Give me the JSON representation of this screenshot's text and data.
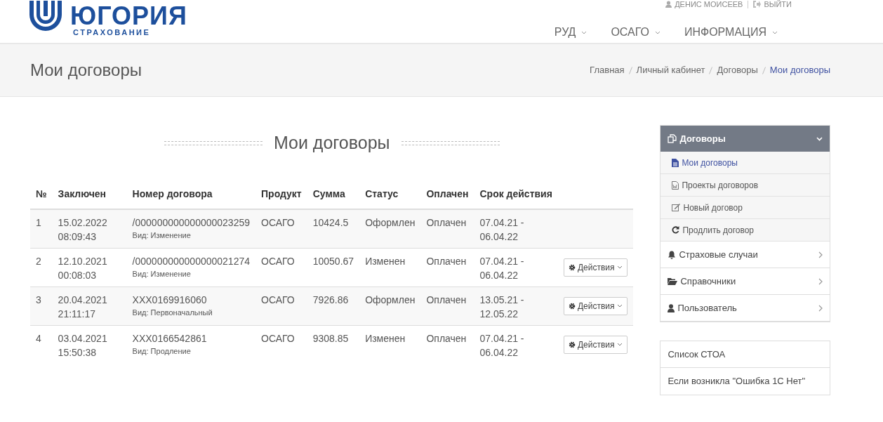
{
  "header": {
    "logo": {
      "name": "ЮГОРИЯ",
      "tagline": "СТРАХОВАНИЕ"
    },
    "user": "ДЕНИС МОИСЕЕВ",
    "logout": "ВЫЙТИ",
    "nav": [
      "РУД",
      "ОСАГО",
      "ИНФОРМАЦИЯ"
    ]
  },
  "page_title": "Мои договоры",
  "breadcrumb": [
    {
      "label": "Главная",
      "selected": false
    },
    {
      "label": "Личный кабинет",
      "selected": false
    },
    {
      "label": "Договоры",
      "selected": false
    },
    {
      "label": "Мои договоры",
      "selected": true
    }
  ],
  "section_title": "Мои договоры",
  "table": {
    "columns": [
      "№",
      "Заключен",
      "Номер договора",
      "Продукт",
      "Сумма",
      "Статус",
      "Оплачен",
      "Срок действия"
    ],
    "rows": [
      {
        "no": "1",
        "concluded": "15.02.2022 08:09:43",
        "number": "/000000000000000023259",
        "kind_label": "Вид: Изменение",
        "product": "ОСАГО",
        "sum": "10424.5",
        "status": "Оформлен",
        "paid": "Оплачен",
        "term": "07.04.21 - 06.04.22"
      },
      {
        "no": "2",
        "concluded": "12.10.2021 00:08:03",
        "number": "/000000000000000021274",
        "kind_label": "Вид: Изменение",
        "product": "ОСАГО",
        "sum": "10050.67",
        "status": "Изменен",
        "paid": "Оплачен",
        "term": "07.04.21 - 06.04.22",
        "action": "Действия"
      },
      {
        "no": "3",
        "concluded": "20.04.2021 21:11:17",
        "number": "XXX0169916060",
        "kind_label": "Вид: Первоначальный",
        "product": "ОСАГО",
        "sum": "7926.86",
        "status": "Оформлен",
        "paid": "Оплачен",
        "term": "13.05.21 - 12.05.22",
        "action": "Действия"
      },
      {
        "no": "4",
        "concluded": "03.04.2021 15:50:38",
        "number": "XXX0166542861",
        "kind_label": "Вид: Продление",
        "product": "ОСАГО",
        "sum": "9308.85",
        "status": "Изменен",
        "paid": "Оплачен",
        "term": "07.04.21 - 06.04.22",
        "action": "Действия"
      }
    ]
  },
  "sidebar": {
    "groups": [
      {
        "label": "Договоры",
        "expanded": true,
        "children": [
          {
            "label": "Мои договоры",
            "selected": true
          },
          {
            "label": "Проекты договоров",
            "selected": false
          },
          {
            "label": "Новый договор",
            "selected": false
          },
          {
            "label": "Продлить договор",
            "selected": false
          }
        ]
      },
      {
        "label": "Страховые случаи",
        "expanded": false
      },
      {
        "label": "Справочники",
        "expanded": false
      },
      {
        "label": "Пользователь",
        "expanded": false
      }
    ],
    "links": [
      "Список СТОА",
      "Если возникла \"Ошибка 1С Нет\""
    ]
  }
}
